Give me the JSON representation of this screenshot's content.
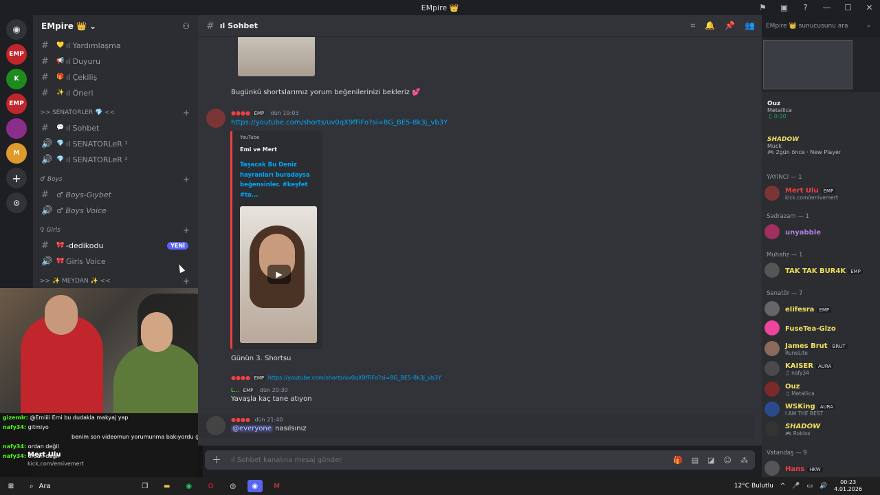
{
  "window": {
    "title": "EMpire 👑"
  },
  "servers": [
    {
      "label": "EMP",
      "color": "#c0262b"
    },
    {
      "label": "K",
      "color": "#53fc18"
    },
    {
      "label": "EMP",
      "color": "#c0262b"
    },
    {
      "label": "",
      "color": "#8b2d8b"
    },
    {
      "label": "M",
      "color": "#e09a2b"
    }
  ],
  "guild": {
    "name": "EMpire 👑",
    "channels": [
      {
        "emoji": "💛",
        "name": "ıl Yardımlaşma",
        "type": "text"
      },
      {
        "emoji": "📢",
        "name": "ıl Duyuru",
        "type": "text"
      },
      {
        "emoji": "🎁",
        "name": "ıl Çekiliş",
        "type": "text"
      },
      {
        "emoji": "✨",
        "name": "ıl Öneri",
        "type": "text"
      }
    ],
    "category_senators": ">> SENATORLER 💎 <<",
    "senator_channels": [
      {
        "emoji": "💬",
        "name": "ıl Sohbet",
        "type": "text"
      },
      {
        "emoji": "💎",
        "name": "ıl SENATORLeR ¹",
        "type": "voice"
      },
      {
        "emoji": "💎",
        "name": "ıl SENATORLeR ²",
        "type": "voice"
      }
    ],
    "category_boys": "♂ Boys",
    "boys_channels": [
      {
        "name": "♂ Boys-Gıybet",
        "type": "text"
      },
      {
        "name": "♂ Boys Voice",
        "type": "voice"
      }
    ],
    "category_girls": "♀ Girls",
    "girls_channels": [
      {
        "emoji": "🎀",
        "name": "-dedikodu",
        "type": "text",
        "badge": "YENİ"
      },
      {
        "emoji": "🎀",
        "name": "Girls Voice",
        "type": "voice"
      }
    ],
    "category_meydan": ">> ✨ MEYDAN ✨ <<"
  },
  "kick_chat": [
    {
      "user": "gizemlr:",
      "text": "@Emiiii Emi bu dudakla makyaj yap"
    },
    {
      "user": "nafy34:",
      "text": "gitmiyo"
    },
    {
      "user": "nafy34:",
      "text": "ordan değil"
    },
    {
      "user": "nafy34:",
      "text": "ordan değil"
    }
  ],
  "user_panel": {
    "name": "Mert Ulu",
    "status": "kick.com/emivemert",
    "kick_message": "benim son videomun yorumunma bakıyordu @emivemert"
  },
  "channel_header": {
    "name": "ıl Sohbet"
  },
  "search": {
    "placeholder": "EMpire 👑 sunucusunu ara"
  },
  "messages": {
    "m1_text": "Bugünkü shortslarımız yorum beğenilerinizi bekleriz 💕",
    "m2_time": "dün 19:03",
    "m2_link": "https://youtube.com/shorts/uv0qX9fFiFo?si=8G_BE5-8k3j_vb3Y",
    "embed_provider": "YouTube",
    "embed_author": "Emi ve Mert",
    "embed_title": "Taşacak Bu Deniz hayranları buradaysa beğensinler. #keşfet #ta...",
    "m2_caption": "Günün 3. Shortsu",
    "m3_reply_link": "https://youtube.com/shorts/uv0qX9fFiFo?si=8G_BE5-8k3j_vb3Y",
    "m3_time": "dün 20:30",
    "m3_text": "Yavaşla kaç tane atıyon",
    "m4_time": "dün 21:40",
    "m4_mention": "@everyone",
    "m4_text": "nasılsınız",
    "tag": "EMP"
  },
  "composer": {
    "placeholder": "ıl Sohbet kanalına mesaj gönder"
  },
  "members": {
    "now_playing": [
      {
        "title": "Ouz",
        "subtitle": "Metallica",
        "detail": "♫ 0:20"
      },
      {
        "title": "SHADOW",
        "subtitle": "Muck",
        "detail": "🎮 2gün önce · New Player"
      }
    ],
    "groups": [
      {
        "title": "YAYINCI — 1",
        "members": [
          {
            "name": "Mert Ulu",
            "color": "#f23f43",
            "badge": "EMP",
            "sub": "kick.com/emivemert"
          }
        ]
      },
      {
        "title": "Sadrazam — 1",
        "members": [
          {
            "name": "unyabble",
            "color": "#b07fe0",
            "badge": "",
            "sub": ""
          }
        ]
      },
      {
        "title": "Muhafız — 1",
        "members": [
          {
            "name": "TAK TAK BUR4K",
            "color": "#f2e05f",
            "badge": "EMP",
            "sub": ""
          }
        ]
      },
      {
        "title": "Senatör — 7",
        "members": [
          {
            "name": "elifesra",
            "color": "#f2e05f",
            "badge": "EMP",
            "sub": ""
          },
          {
            "name": "FuseTea-Glzo",
            "color": "#f2e05f",
            "badge": "",
            "sub": ""
          },
          {
            "name": "James Brut",
            "color": "#f2e05f",
            "badge": "BRUT",
            "sub": "RuneLite"
          },
          {
            "name": "KAISER",
            "color": "#f2e05f",
            "badge": "AURA",
            "sub": "♫ nafy34"
          },
          {
            "name": "Ouz",
            "color": "#f2e05f",
            "badge": "",
            "sub": "♫ Metallica"
          },
          {
            "name": "WSKing",
            "color": "#f2e05f",
            "badge": "AURA",
            "sub": "I AM THE BEST"
          },
          {
            "name": "SHADOW",
            "color": "#f2e05f",
            "badge": "",
            "sub": "🎮 Roblox"
          }
        ]
      },
      {
        "title": "Vatandaş — 9",
        "members": [
          {
            "name": "Hans",
            "color": "#f23f43",
            "badge": "HKW",
            "sub": ""
          }
        ]
      }
    ]
  },
  "taskbar": {
    "search_label": "Ara",
    "weather": "12°C  Bulutlu",
    "time": "00:23",
    "date": "4.01.2026"
  }
}
